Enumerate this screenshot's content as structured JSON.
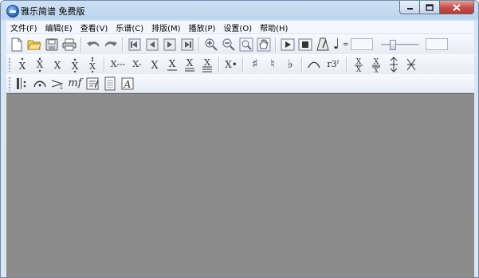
{
  "window": {
    "title": "雅乐简谱 免费版"
  },
  "menu": [
    {
      "label": "文件(F)"
    },
    {
      "label": "编辑(E)"
    },
    {
      "label": "查看(V)"
    },
    {
      "label": "乐谱(C)"
    },
    {
      "label": "排版(M)"
    },
    {
      "label": "播放(P)"
    },
    {
      "label": "设置(O)"
    },
    {
      "label": "帮助(H)"
    }
  ],
  "toolbar": {
    "tempo_symbol": "=",
    "note_glyph": "♩",
    "articulation_labels": {
      "x_dash_long": "X---",
      "x_dash": "X-",
      "x_dot": "X•",
      "triplet": "r3ˀ",
      "mf": "mf"
    },
    "accidentals": {
      "sharp": "♯",
      "natural": "♮",
      "flat": "♭"
    }
  },
  "icons": [
    "new-icon",
    "open-icon",
    "save-icon",
    "print-icon",
    "undo-icon",
    "redo-icon",
    "page-first-icon",
    "page-prev-icon",
    "page-next-icon",
    "page-last-icon",
    "zoom-in-icon",
    "zoom-out-icon",
    "zoom-fit-icon",
    "hand-icon",
    "play-icon",
    "stop-icon",
    "metronome-icon",
    "quarter-note-icon"
  ]
}
